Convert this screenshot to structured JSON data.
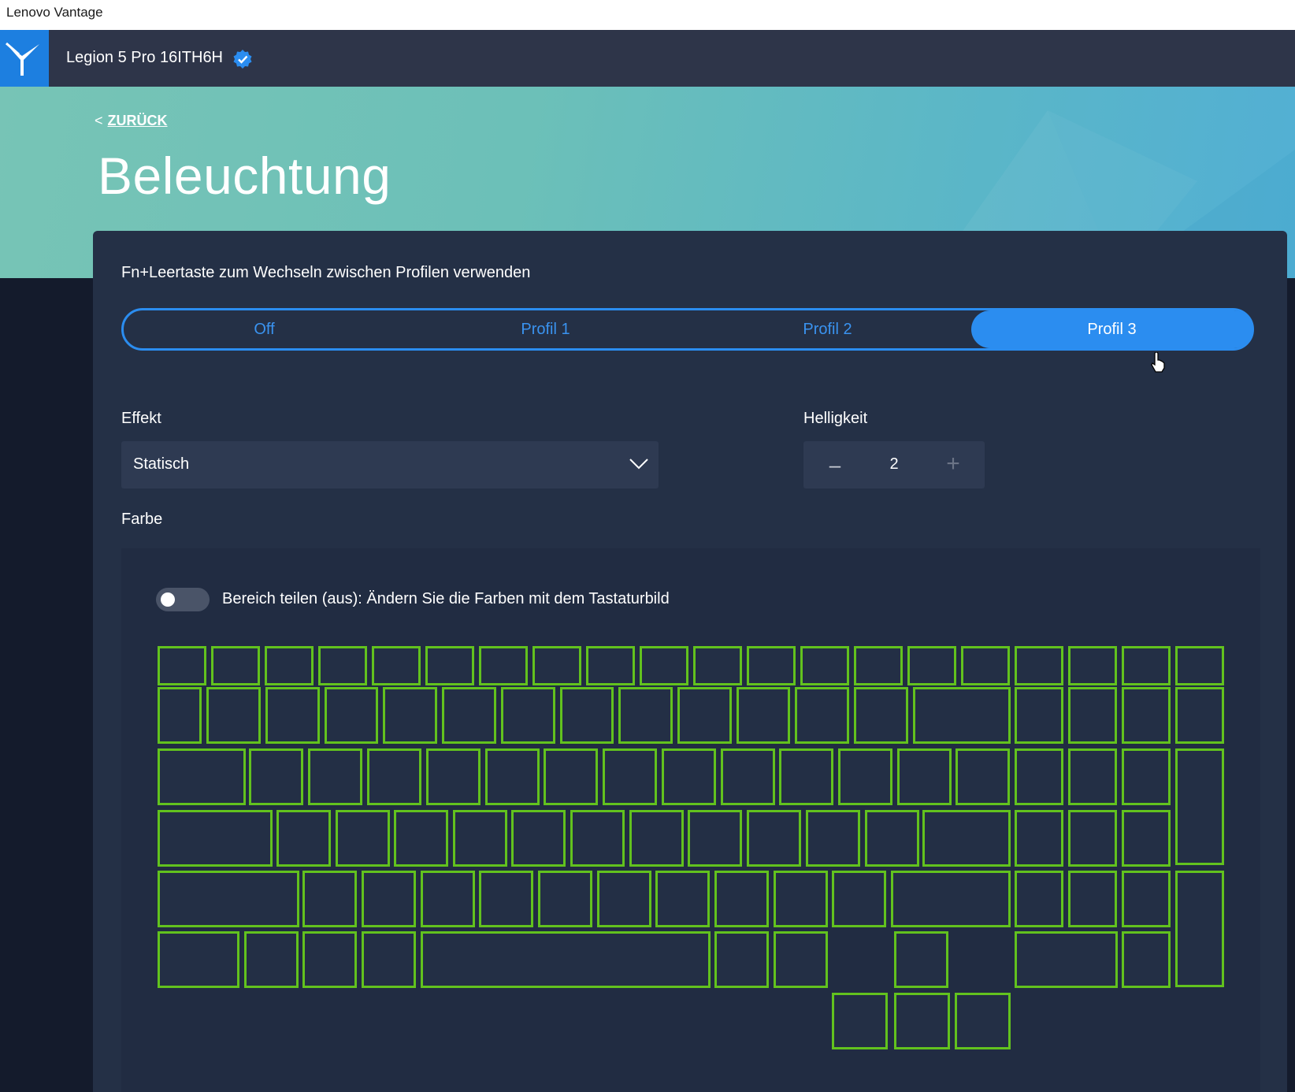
{
  "window": {
    "title": "Lenovo Vantage"
  },
  "header": {
    "device_name": "Legion 5 Pro 16ITH6H",
    "logo_icon": "legion-logo-icon",
    "verified_icon": "verified-check-icon"
  },
  "banner": {
    "back_chevron": "<",
    "back_label": "ZURÜCK",
    "title": "Beleuchtung"
  },
  "profiles": {
    "hint": "Fn+Leertaste zum Wechseln zwischen Profilen verwenden",
    "options": [
      "Off",
      "Profil 1",
      "Profil 2",
      "Profil 3"
    ],
    "selected": "Profil 3"
  },
  "effect": {
    "label": "Effekt",
    "value": "Statisch"
  },
  "brightness": {
    "label": "Helligkeit",
    "value": "2",
    "minus": "–",
    "plus": "+"
  },
  "color": {
    "label": "Farbe",
    "split_toggle_label": "Bereich teilen (aus): Ändern Sie die Farben mit dem Tastaturbild",
    "split_toggle_on": false,
    "key_color": "#62c21e"
  },
  "colors": {
    "accent": "#2b8df0",
    "card": "#243046",
    "background": "#141b2c"
  }
}
